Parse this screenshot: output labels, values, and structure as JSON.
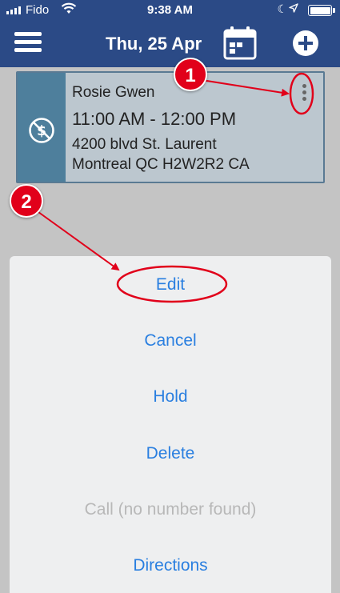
{
  "status_bar": {
    "carrier": "Fido",
    "time": "9:38 AM"
  },
  "nav": {
    "date": "Thu, 25 Apr"
  },
  "appointment": {
    "name": "Rosie Gwen",
    "time_range": "11:00 AM - 12:00 PM",
    "address_line1": "4200 blvd St. Laurent",
    "address_line2": "Montreal QC H2W2R2 CA"
  },
  "action_sheet": {
    "items": [
      {
        "label": "Edit",
        "enabled": true
      },
      {
        "label": "Cancel",
        "enabled": true
      },
      {
        "label": "Hold",
        "enabled": true
      },
      {
        "label": "Delete",
        "enabled": true
      },
      {
        "label": "Call (no number found)",
        "enabled": false
      },
      {
        "label": "Directions",
        "enabled": true
      }
    ]
  },
  "annotations": {
    "badge_1": "1",
    "badge_2": "2"
  },
  "colors": {
    "header": "#2b4a86",
    "card_strip": "#4e7f9c",
    "card_bg": "#bcc7cf",
    "action_text": "#2a7fe0",
    "annotation_red": "#e1001a"
  },
  "icons": {
    "menu": "hamburger-icon",
    "calendar": "calendar-icon",
    "add": "plus-circle-icon",
    "payment": "no-payment-icon",
    "more": "kebab-icon"
  }
}
